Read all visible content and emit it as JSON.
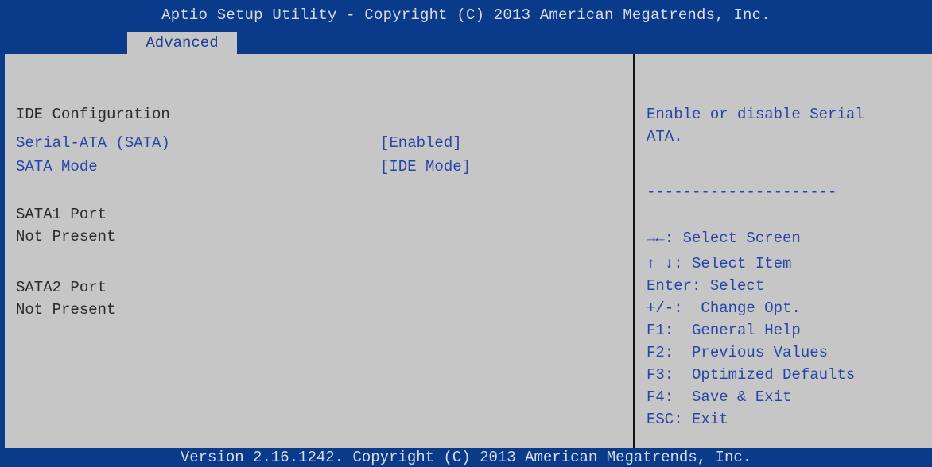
{
  "header": {
    "title": "Aptio Setup Utility - Copyright (C) 2013 American Megatrends, Inc."
  },
  "tabs": [
    {
      "label": "Advanced",
      "active": true
    }
  ],
  "main": {
    "section_title": "IDE Configuration",
    "settings": [
      {
        "label": "Serial-ATA (SATA)",
        "value": "[Enabled]"
      },
      {
        "label": "SATA Mode",
        "value": "[IDE Mode]"
      }
    ],
    "ports": [
      {
        "label": "SATA1 Port",
        "status": "Not Present"
      },
      {
        "label": "SATA2 Port",
        "status": "Not Present"
      }
    ]
  },
  "help": {
    "description_line1": "Enable or disable Serial",
    "description_line2": "ATA.",
    "separator": "---------------------",
    "keys": [
      {
        "text": "→←: Select Screen"
      },
      {
        "text": "↑ ↓: Select Item"
      },
      {
        "text": "Enter: Select"
      },
      {
        "text": "+/-:  Change Opt."
      },
      {
        "text": "F1:  General Help"
      },
      {
        "text": "F2:  Previous Values"
      },
      {
        "text": "F3:  Optimized Defaults"
      },
      {
        "text": "F4:  Save & Exit"
      },
      {
        "text": "ESC: Exit"
      }
    ]
  },
  "footer": {
    "text": "Version 2.16.1242. Copyright (C) 2013 American Megatrends, Inc."
  },
  "colors": {
    "background_blue": "#0a3a8a",
    "panel_gray": "#c6c6c6",
    "item_blue": "#2546a8",
    "text_dark": "#2a2a2a"
  }
}
